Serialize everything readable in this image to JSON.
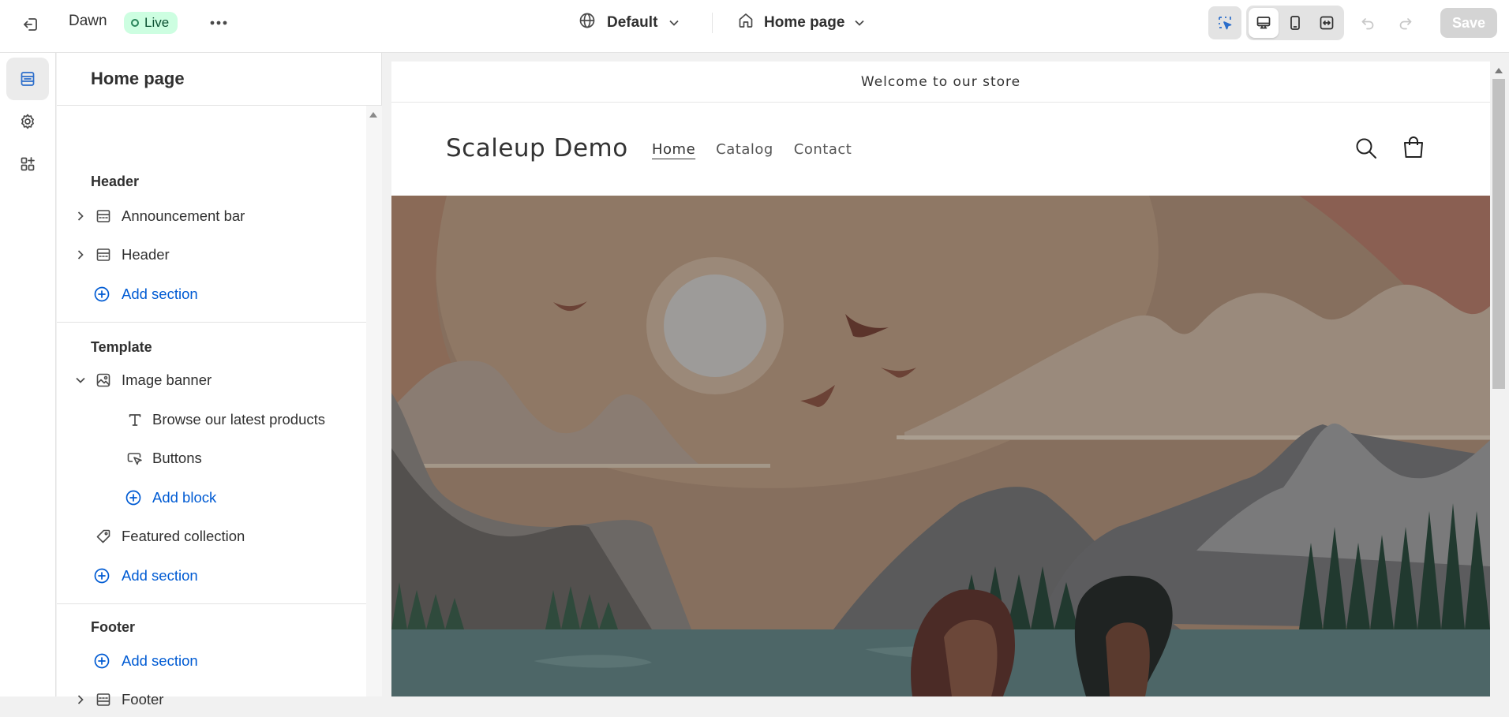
{
  "topbar": {
    "theme_name": "Dawn",
    "status": "Live",
    "locale_label": "Default",
    "page_label": "Home page",
    "save_label": "Save"
  },
  "sidebar": {
    "title": "Home page",
    "header_group": {
      "heading": "Header",
      "items": [
        {
          "label": "Announcement bar"
        },
        {
          "label": "Header"
        }
      ],
      "add_label": "Add section"
    },
    "template_group": {
      "heading": "Template",
      "image_banner": "Image banner",
      "blocks": [
        {
          "label": "Browse our latest products"
        },
        {
          "label": "Buttons"
        }
      ],
      "add_block_label": "Add block",
      "featured": "Featured collection",
      "add_label": "Add section"
    },
    "footer_group": {
      "heading": "Footer",
      "add_label": "Add section",
      "items": [
        {
          "label": "Footer"
        }
      ]
    }
  },
  "preview": {
    "announcement": "Welcome to our store",
    "store_name": "Scaleup Demo",
    "nav": [
      "Home",
      "Catalog",
      "Contact"
    ]
  },
  "colors": {
    "accent": "#005bd3",
    "live_bg": "#cdfee1",
    "live_text": "#0c5132"
  }
}
